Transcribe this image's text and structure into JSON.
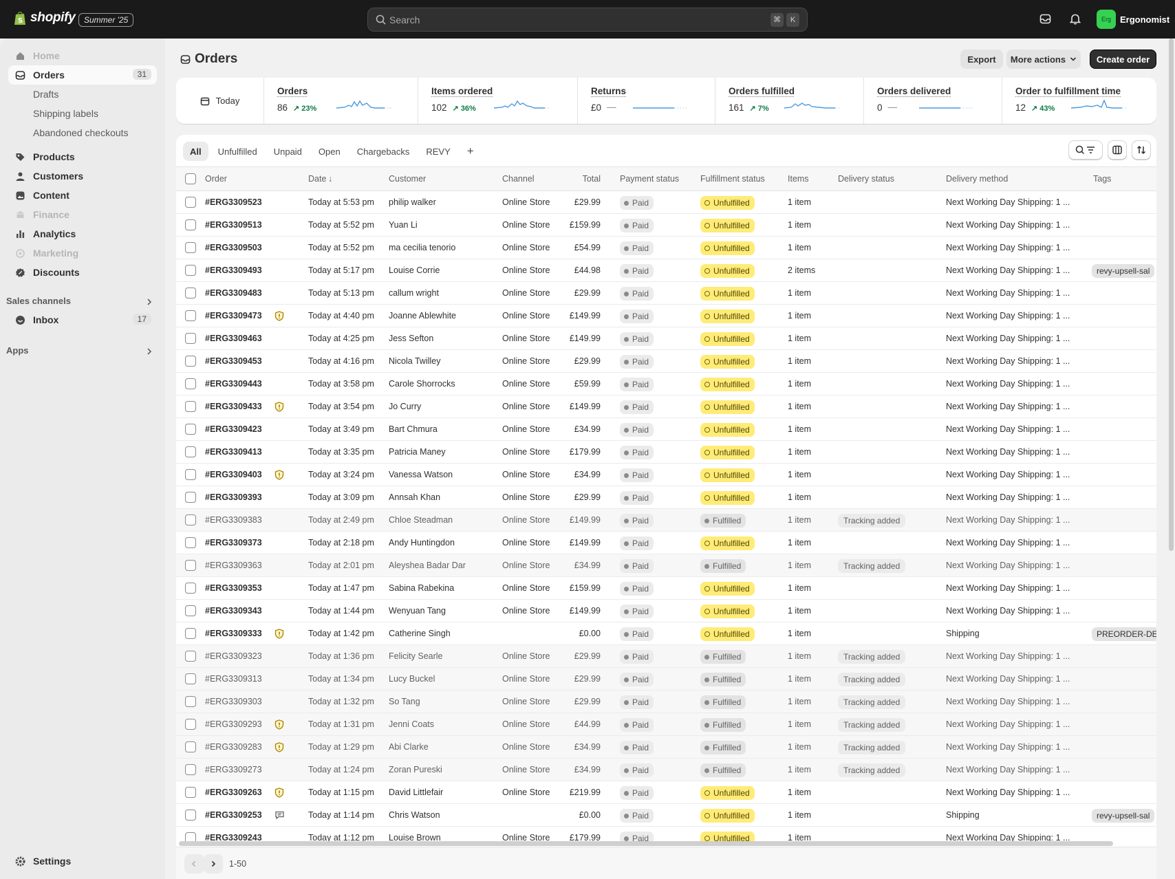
{
  "topbar": {
    "brand": "shopify",
    "edition": "Summer '25",
    "search_placeholder": "Search",
    "shortcut_keys": [
      "⌘",
      "K"
    ],
    "store_avatar": "Erg",
    "store_name": "Ergonomist"
  },
  "sidebar": {
    "items": [
      {
        "label": "Home",
        "icon": "home-icon",
        "state": "disabled"
      },
      {
        "label": "Orders",
        "icon": "orders-icon",
        "state": "active",
        "count": "31"
      },
      {
        "label": "Drafts",
        "state": "sub"
      },
      {
        "label": "Shipping labels",
        "state": "sub"
      },
      {
        "label": "Abandoned checkouts",
        "state": "sub"
      },
      {
        "label": "Products",
        "icon": "tag-icon"
      },
      {
        "label": "Customers",
        "icon": "person-icon"
      },
      {
        "label": "Content",
        "icon": "content-icon"
      },
      {
        "label": "Finance",
        "icon": "bank-icon",
        "state": "disabled"
      },
      {
        "label": "Analytics",
        "icon": "bar-chart-icon"
      },
      {
        "label": "Marketing",
        "icon": "target-icon",
        "state": "disabled"
      },
      {
        "label": "Discounts",
        "icon": "discount-icon"
      }
    ],
    "sales_channels_label": "Sales channels",
    "inbox": {
      "label": "Inbox",
      "count": "17"
    },
    "apps_label": "Apps",
    "settings_label": "Settings"
  },
  "page": {
    "title": "Orders",
    "export_label": "Export",
    "more_actions_label": "More actions",
    "create_order_label": "Create order"
  },
  "metrics": {
    "date_label": "Today",
    "items": [
      {
        "label": "Orders",
        "value": "86",
        "delta": "23%"
      },
      {
        "label": "Items ordered",
        "value": "102",
        "delta": "36%"
      },
      {
        "label": "Returns",
        "value": "£0",
        "delta": "—"
      },
      {
        "label": "Orders fulfilled",
        "value": "161",
        "delta": "7%"
      },
      {
        "label": "Orders delivered",
        "value": "0",
        "delta": "—"
      },
      {
        "label": "Order to fulfillment time",
        "value": "12",
        "delta": "43%"
      }
    ]
  },
  "tabs": [
    "All",
    "Unfulfilled",
    "Unpaid",
    "Open",
    "Chargebacks",
    "REVY",
    "+"
  ],
  "columns": [
    "Order",
    "Date",
    "Customer",
    "Channel",
    "Total",
    "Payment status",
    "Fulfillment status",
    "Items",
    "Delivery status",
    "Delivery method",
    "Tags"
  ],
  "rows": [
    {
      "order": "#ERG3309523",
      "date": "Today at 5:53 pm",
      "customer": "philip walker",
      "channel": "Online Store",
      "total": "£29.99",
      "payment": "Paid",
      "fulfillment": "Unfulfilled",
      "items": "1 item",
      "delivery": "",
      "method": "Next Working Day Shipping: 1 ...",
      "tag": "",
      "icon": ""
    },
    {
      "order": "#ERG3309513",
      "date": "Today at 5:52 pm",
      "customer": "Yuan Li",
      "channel": "Online Store",
      "total": "£159.99",
      "payment": "Paid",
      "fulfillment": "Unfulfilled",
      "items": "1 item",
      "delivery": "",
      "method": "Next Working Day Shipping: 1 ...",
      "tag": "",
      "icon": ""
    },
    {
      "order": "#ERG3309503",
      "date": "Today at 5:52 pm",
      "customer": "ma cecilia tenorio",
      "channel": "Online Store",
      "total": "£54.99",
      "payment": "Paid",
      "fulfillment": "Unfulfilled",
      "items": "1 item",
      "delivery": "",
      "method": "Next Working Day Shipping: 1 ...",
      "tag": "",
      "icon": ""
    },
    {
      "order": "#ERG3309493",
      "date": "Today at 5:17 pm",
      "customer": "Louise Corrie",
      "channel": "Online Store",
      "total": "£44.98",
      "payment": "Paid",
      "fulfillment": "Unfulfilled",
      "items": "2 items",
      "delivery": "",
      "method": "Next Working Day Shipping: 1 ...",
      "tag": "revy-upsell-sal",
      "icon": ""
    },
    {
      "order": "#ERG3309483",
      "date": "Today at 5:13 pm",
      "customer": "callum wright",
      "channel": "Online Store",
      "total": "£29.99",
      "payment": "Paid",
      "fulfillment": "Unfulfilled",
      "items": "1 item",
      "delivery": "",
      "method": "Next Working Day Shipping: 1 ...",
      "tag": "",
      "icon": ""
    },
    {
      "order": "#ERG3309473",
      "date": "Today at 4:40 pm",
      "customer": "Joanne Ablewhite",
      "channel": "Online Store",
      "total": "£149.99",
      "payment": "Paid",
      "fulfillment": "Unfulfilled",
      "items": "1 item",
      "delivery": "",
      "method": "Next Working Day Shipping: 1 ...",
      "tag": "",
      "icon": "shield"
    },
    {
      "order": "#ERG3309463",
      "date": "Today at 4:25 pm",
      "customer": "Jess Sefton",
      "channel": "Online Store",
      "total": "£149.99",
      "payment": "Paid",
      "fulfillment": "Unfulfilled",
      "items": "1 item",
      "delivery": "",
      "method": "Next Working Day Shipping: 1 ...",
      "tag": "",
      "icon": ""
    },
    {
      "order": "#ERG3309453",
      "date": "Today at 4:16 pm",
      "customer": "Nicola Twilley",
      "channel": "Online Store",
      "total": "£29.99",
      "payment": "Paid",
      "fulfillment": "Unfulfilled",
      "items": "1 item",
      "delivery": "",
      "method": "Next Working Day Shipping: 1 ...",
      "tag": "",
      "icon": ""
    },
    {
      "order": "#ERG3309443",
      "date": "Today at 3:58 pm",
      "customer": "Carole Shorrocks",
      "channel": "Online Store",
      "total": "£59.99",
      "payment": "Paid",
      "fulfillment": "Unfulfilled",
      "items": "1 item",
      "delivery": "",
      "method": "Next Working Day Shipping: 1 ...",
      "tag": "",
      "icon": ""
    },
    {
      "order": "#ERG3309433",
      "date": "Today at 3:54 pm",
      "customer": "Jo Curry",
      "channel": "Online Store",
      "total": "£149.99",
      "payment": "Paid",
      "fulfillment": "Unfulfilled",
      "items": "1 item",
      "delivery": "",
      "method": "Next Working Day Shipping: 1 ...",
      "tag": "",
      "icon": "shield"
    },
    {
      "order": "#ERG3309423",
      "date": "Today at 3:49 pm",
      "customer": "Bart Chmura",
      "channel": "Online Store",
      "total": "£34.99",
      "payment": "Paid",
      "fulfillment": "Unfulfilled",
      "items": "1 item",
      "delivery": "",
      "method": "Next Working Day Shipping: 1 ...",
      "tag": "",
      "icon": ""
    },
    {
      "order": "#ERG3309413",
      "date": "Today at 3:35 pm",
      "customer": "Patricia Maney",
      "channel": "Online Store",
      "total": "£179.99",
      "payment": "Paid",
      "fulfillment": "Unfulfilled",
      "items": "1 item",
      "delivery": "",
      "method": "Next Working Day Shipping: 1 ...",
      "tag": "",
      "icon": ""
    },
    {
      "order": "#ERG3309403",
      "date": "Today at 3:24 pm",
      "customer": "Vanessa Watson",
      "channel": "Online Store",
      "total": "£34.99",
      "payment": "Paid",
      "fulfillment": "Unfulfilled",
      "items": "1 item",
      "delivery": "",
      "method": "Next Working Day Shipping: 1 ...",
      "tag": "",
      "icon": "shield"
    },
    {
      "order": "#ERG3309393",
      "date": "Today at 3:09 pm",
      "customer": "Annsah Khan",
      "channel": "Online Store",
      "total": "£29.99",
      "payment": "Paid",
      "fulfillment": "Unfulfilled",
      "items": "1 item",
      "delivery": "",
      "method": "Next Working Day Shipping: 1 ...",
      "tag": "",
      "icon": ""
    },
    {
      "order": "#ERG3309383",
      "date": "Today at 2:49 pm",
      "customer": "Chloe Steadman",
      "channel": "Online Store",
      "total": "£149.99",
      "payment": "Paid",
      "fulfillment": "Fulfilled",
      "items": "1 item",
      "delivery": "Tracking added",
      "method": "Next Working Day Shipping: 1 ...",
      "tag": "",
      "icon": ""
    },
    {
      "order": "#ERG3309373",
      "date": "Today at 2:18 pm",
      "customer": "Andy Huntingdon",
      "channel": "Online Store",
      "total": "£149.99",
      "payment": "Paid",
      "fulfillment": "Unfulfilled",
      "items": "1 item",
      "delivery": "",
      "method": "Next Working Day Shipping: 1 ...",
      "tag": "",
      "icon": ""
    },
    {
      "order": "#ERG3309363",
      "date": "Today at 2:01 pm",
      "customer": "Aleyshea Badar Dar",
      "channel": "Online Store",
      "total": "£34.99",
      "payment": "Paid",
      "fulfillment": "Fulfilled",
      "items": "1 item",
      "delivery": "Tracking added",
      "method": "Next Working Day Shipping: 1 ...",
      "tag": "",
      "icon": ""
    },
    {
      "order": "#ERG3309353",
      "date": "Today at 1:47 pm",
      "customer": "Sabina Rabekina",
      "channel": "Online Store",
      "total": "£159.99",
      "payment": "Paid",
      "fulfillment": "Unfulfilled",
      "items": "1 item",
      "delivery": "",
      "method": "Next Working Day Shipping: 1 ...",
      "tag": "",
      "icon": ""
    },
    {
      "order": "#ERG3309343",
      "date": "Today at 1:44 pm",
      "customer": "Wenyuan Tang",
      "channel": "Online Store",
      "total": "£149.99",
      "payment": "Paid",
      "fulfillment": "Unfulfilled",
      "items": "1 item",
      "delivery": "",
      "method": "Next Working Day Shipping: 1 ...",
      "tag": "",
      "icon": ""
    },
    {
      "order": "#ERG3309333",
      "date": "Today at 1:42 pm",
      "customer": "Catherine Singh",
      "channel": "",
      "total": "£0.00",
      "payment": "Paid",
      "fulfillment": "Unfulfilled",
      "items": "1 item",
      "delivery": "",
      "method": "Shipping",
      "tag": "PREORDER-DE",
      "icon": "shield"
    },
    {
      "order": "#ERG3309323",
      "date": "Today at 1:36 pm",
      "customer": "Felicity Searle",
      "channel": "Online Store",
      "total": "£29.99",
      "payment": "Paid",
      "fulfillment": "Fulfilled",
      "items": "1 item",
      "delivery": "Tracking added",
      "method": "Next Working Day Shipping: 1 ...",
      "tag": "",
      "icon": ""
    },
    {
      "order": "#ERG3309313",
      "date": "Today at 1:34 pm",
      "customer": "Lucy Buckel",
      "channel": "Online Store",
      "total": "£29.99",
      "payment": "Paid",
      "fulfillment": "Fulfilled",
      "items": "1 item",
      "delivery": "Tracking added",
      "method": "Next Working Day Shipping: 1 ...",
      "tag": "",
      "icon": ""
    },
    {
      "order": "#ERG3309303",
      "date": "Today at 1:32 pm",
      "customer": "So Tang",
      "channel": "Online Store",
      "total": "£29.99",
      "payment": "Paid",
      "fulfillment": "Fulfilled",
      "items": "1 item",
      "delivery": "Tracking added",
      "method": "Next Working Day Shipping: 1 ...",
      "tag": "",
      "icon": ""
    },
    {
      "order": "#ERG3309293",
      "date": "Today at 1:31 pm",
      "customer": "Jenni Coats",
      "channel": "Online Store",
      "total": "£44.99",
      "payment": "Paid",
      "fulfillment": "Fulfilled",
      "items": "1 item",
      "delivery": "Tracking added",
      "method": "Next Working Day Shipping: 1 ...",
      "tag": "",
      "icon": "shield"
    },
    {
      "order": "#ERG3309283",
      "date": "Today at 1:29 pm",
      "customer": "Abi Clarke",
      "channel": "Online Store",
      "total": "£34.99",
      "payment": "Paid",
      "fulfillment": "Fulfilled",
      "items": "1 item",
      "delivery": "Tracking added",
      "method": "Next Working Day Shipping: 1 ...",
      "tag": "",
      "icon": "shield"
    },
    {
      "order": "#ERG3309273",
      "date": "Today at 1:24 pm",
      "customer": "Zoran Pureski",
      "channel": "Online Store",
      "total": "£34.99",
      "payment": "Paid",
      "fulfillment": "Fulfilled",
      "items": "1 item",
      "delivery": "Tracking added",
      "method": "Next Working Day Shipping: 1 ...",
      "tag": "",
      "icon": ""
    },
    {
      "order": "#ERG3309263",
      "date": "Today at 1:15 pm",
      "customer": "David Littlefair",
      "channel": "Online Store",
      "total": "£219.99",
      "payment": "Paid",
      "fulfillment": "Unfulfilled",
      "items": "1 item",
      "delivery": "",
      "method": "Next Working Day Shipping: 1 ...",
      "tag": "",
      "icon": "shield"
    },
    {
      "order": "#ERG3309253",
      "date": "Today at 1:14 pm",
      "customer": "Chris Watson",
      "channel": "",
      "total": "£0.00",
      "payment": "Paid",
      "fulfillment": "Unfulfilled",
      "items": "1 item",
      "delivery": "",
      "method": "Shipping",
      "tag": "revy-upsell-sal",
      "icon": "note"
    },
    {
      "order": "#ERG3309243",
      "date": "Today at 1:12 pm",
      "customer": "Louise Brown",
      "channel": "Online Store",
      "total": "£179.99",
      "payment": "Paid",
      "fulfillment": "Unfulfilled",
      "items": "1 item",
      "delivery": "",
      "method": "Next Working Day Shipping: 1 ...",
      "tag": "",
      "icon": ""
    }
  ],
  "pagination": {
    "range": "1-50"
  },
  "colors": {
    "topbar": "#1a1a1a",
    "unfulfilled_badge": "#ffeb78",
    "avatar": "#36d153",
    "positive_delta": "#0c7a43"
  }
}
